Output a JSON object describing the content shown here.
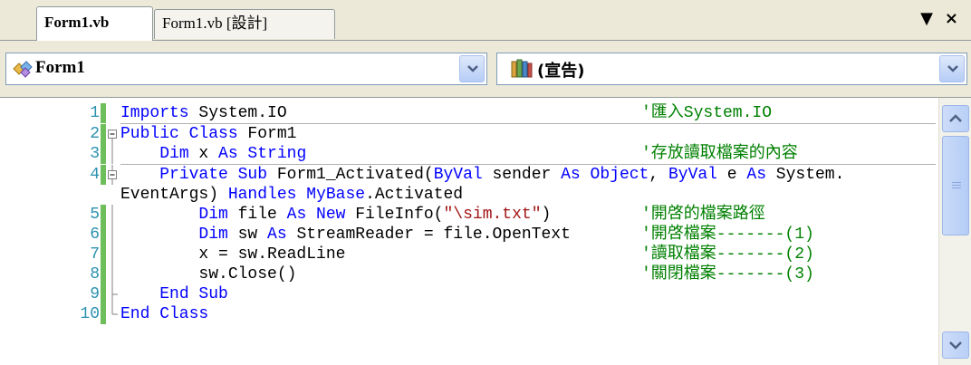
{
  "tabs": [
    {
      "label": "Form1.vb",
      "active": true
    },
    {
      "label": "Form1.vb [設計]",
      "active": false
    }
  ],
  "window_controls": {
    "dropdown_icon": "▼",
    "close_icon": "×"
  },
  "navbar": {
    "class_combo": {
      "value": "Form1",
      "icon": "class-icon"
    },
    "member_combo": {
      "value": "(宣告)",
      "icon": "declarations-icon"
    }
  },
  "code_lines": [
    {
      "num": "1",
      "code": "Imports System.IO",
      "comment": "'匯入System.IO"
    },
    {
      "num": "2",
      "code": "Public Class Form1",
      "comment": ""
    },
    {
      "num": "3",
      "code": "    Dim x As String",
      "comment": "'存放讀取檔案的內容"
    },
    {
      "num": "4",
      "code": "    Private Sub Form1_Activated(ByVal sender As Object, ByVal e As System.",
      "comment": ""
    },
    {
      "num": "",
      "code": "EventArgs) Handles MyBase.Activated",
      "comment": ""
    },
    {
      "num": "5",
      "code": "        Dim file As New FileInfo(\"\\sim.txt\")",
      "comment": "'開啓的檔案路徑"
    },
    {
      "num": "6",
      "code": "        Dim sw As StreamReader = file.OpenText",
      "comment": "'開啓檔案-------(1)"
    },
    {
      "num": "7",
      "code": "        x = sw.ReadLine",
      "comment": "'讀取檔案-------(2)"
    },
    {
      "num": "8",
      "code": "        sw.Close()",
      "comment": "'關閉檔案-------(3)"
    },
    {
      "num": "9",
      "code": "    End Sub",
      "comment": ""
    },
    {
      "num": "10",
      "code": "End Class",
      "comment": ""
    }
  ],
  "colors": {
    "keyword": "#0000ff",
    "string": "#a31515",
    "comment": "#008000",
    "line_number": "#2b91af",
    "change_bar": "#6fbe5c"
  }
}
